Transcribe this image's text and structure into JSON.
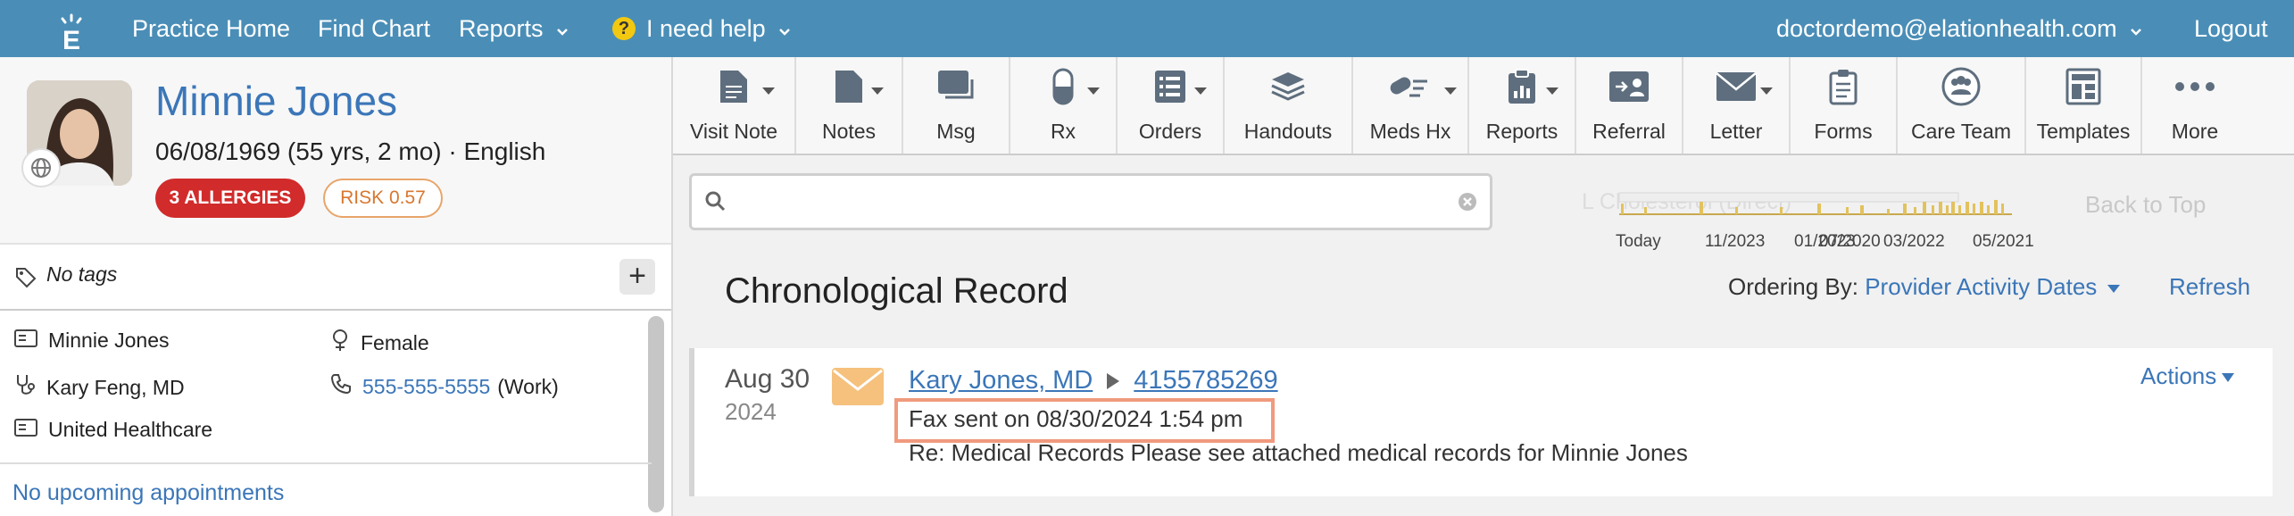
{
  "topnav": {
    "practice_home": "Practice Home",
    "find_chart": "Find Chart",
    "reports": "Reports",
    "help": "I need help",
    "help_badge": "?",
    "user_email": "doctordemo@elationhealth.com",
    "logout": "Logout"
  },
  "patient": {
    "name": "Minnie Jones",
    "dob_line": "06/08/1969 (55 yrs, 2 mo) · English",
    "allergies_badge": "3 ALLERGIES",
    "risk_badge": "RISK 0.57",
    "tags": "No tags",
    "add_tag": "+",
    "details": {
      "name": "Minnie Jones",
      "sex": "Female",
      "provider": "Kary Feng, MD",
      "phone": "555-555-5555",
      "phone_type": "(Work)",
      "insurance": "United Healthcare"
    },
    "appointments": "No upcoming appointments"
  },
  "toolbar": [
    {
      "label": "Visit Note",
      "icon": "document-icon"
    },
    {
      "label": "Notes",
      "icon": "notes-icon"
    },
    {
      "label": "Msg",
      "icon": "message-icon"
    },
    {
      "label": "Rx",
      "icon": "pill-icon"
    },
    {
      "label": "Orders",
      "icon": "list-icon"
    },
    {
      "label": "Handouts",
      "icon": "layers-icon"
    },
    {
      "label": "Meds Hx",
      "icon": "meds-icon"
    },
    {
      "label": "Reports",
      "icon": "clipboard-icon"
    },
    {
      "label": "Referral",
      "icon": "referral-icon"
    },
    {
      "label": "Letter",
      "icon": "envelope-icon"
    },
    {
      "label": "Forms",
      "icon": "form-icon"
    },
    {
      "label": "Care Team",
      "icon": "care-team-icon"
    },
    {
      "label": "Templates",
      "icon": "template-icon"
    },
    {
      "label": "More",
      "icon": "more-icon"
    }
  ],
  "search": {
    "placeholder": ""
  },
  "timeline": {
    "ghost_text": "L Cholesterol (Direct)",
    "labels": [
      "Today",
      "11/2023",
      "01/2023",
      "03/2022",
      "05/2021",
      "07/2020"
    ],
    "back_to_top": "Back to Top"
  },
  "record": {
    "title": "Chronological Record",
    "ordering_label": "Ordering By:",
    "ordering_value": "Provider Activity Dates",
    "refresh": "Refresh"
  },
  "entry": {
    "date_day": "Aug 30",
    "date_year": "2024",
    "from": "Kary Jones, MD",
    "to": "4155785269",
    "fax_status": "Fax sent on 08/30/2024 1:54 pm",
    "subject": "Re: Medical Records Please see attached medical records for Minnie Jones",
    "actions": "Actions"
  },
  "colors": {
    "header": "#4a8eb7",
    "link": "#3b76b8",
    "allergy": "#d12b2b",
    "risk": "#d8772f",
    "highlight": "#f09a7e",
    "envelope": "#f5c17d"
  }
}
